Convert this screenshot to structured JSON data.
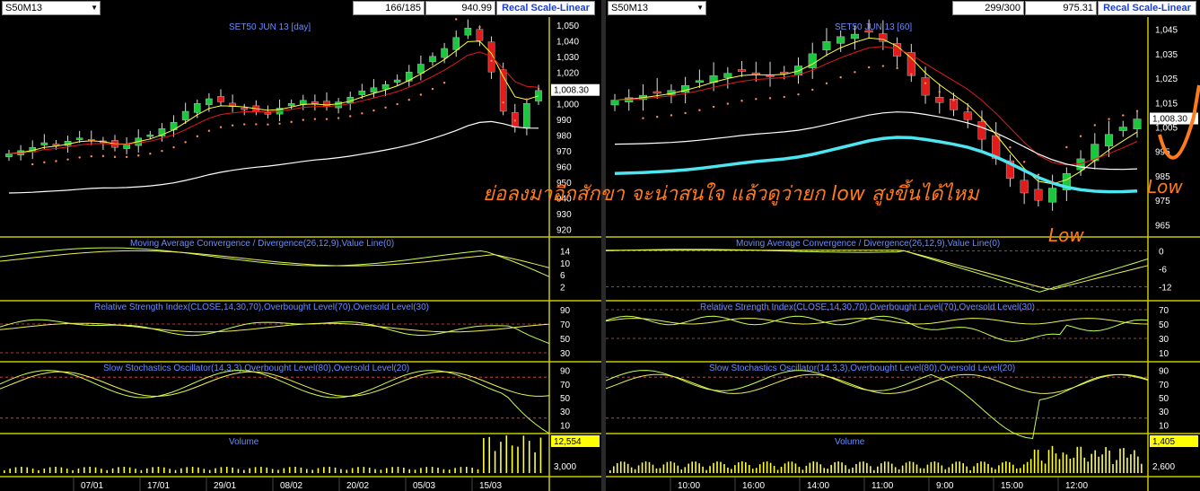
{
  "left": {
    "symbol": "S50M13",
    "bars_count": "166/185",
    "value": "940.99",
    "recal_label": "Recal Scale-Linear",
    "price_title": "SET50 JUN 13   [day]",
    "price_ticks": [
      "1,050",
      "1,040",
      "1,030",
      "1,020",
      "1,010",
      "1,000",
      "990",
      "980",
      "970",
      "960",
      "950",
      "940",
      "930",
      "920"
    ],
    "last_price": "1,008.30",
    "macd_title": "Moving Average Convergence / Divergence(26,12,9),Value Line(0)",
    "macd_ticks": [
      "14",
      "10",
      "6",
      "2"
    ],
    "rsi_title": "Relative Strength Index(CLOSE,14,30,70),Overbought Level(70),Oversold Level(30)",
    "rsi_ticks": [
      "90",
      "70",
      "50",
      "30"
    ],
    "stoch_title": "Slow Stochastics Oscillator(14,3,3),Overbought Level(80),Oversold Level(20)",
    "stoch_ticks": [
      "90",
      "70",
      "50",
      "30",
      "10"
    ],
    "volume_title": "Volume",
    "volume_last": "12,554",
    "volume_tick": "3,000",
    "dates": [
      "07/01",
      "17/01",
      "29/01",
      "08/02",
      "20/02",
      "05/03",
      "15/03"
    ]
  },
  "right": {
    "symbol": "S50M13",
    "bars_count": "299/300",
    "value": "975.31",
    "recal_label": "Recal Scale-Linear",
    "price_title": "SET50 JUN 13   [60]",
    "price_ticks": [
      "1,045",
      "1,035",
      "1,025",
      "1,015",
      "1,005",
      "995",
      "985",
      "975",
      "965"
    ],
    "last_price": "1,008.30",
    "macd_title": "Moving Average Convergence / Divergence(26,12,9),Value Line(0)",
    "macd_ticks": [
      "0",
      "-6",
      "-12"
    ],
    "rsi_title": "Relative Strength Index(CLOSE,14,30,70),Overbought Level(70),Oversold Level(30)",
    "rsi_ticks": [
      "70",
      "50",
      "30",
      "10"
    ],
    "stoch_title": "Slow Stochastics Oscillator(14,3,3),Overbought Level(80),Oversold Level(20)",
    "stoch_ticks": [
      "90",
      "70",
      "50",
      "30",
      "10"
    ],
    "volume_title": "Volume",
    "volume_last": "1,405",
    "volume_tick": "2,600",
    "times": [
      "10:00",
      "16:00",
      "14:00",
      "11:00",
      "9:00",
      "15:00",
      "12:00"
    ]
  },
  "annotations": {
    "main_text": "ย่อลงมาอีกสักขา จะน่าสนใจ แล้วดูว่ายก low สูงขึ้นได้ไหม",
    "low_label_1": "Low",
    "low_label_2": "Low"
  },
  "colors": {
    "up": "#19c83c",
    "down": "#e21b1b",
    "ma_fast": "#ffff3c",
    "ma_mid": "#e21b1b",
    "ma_slow": "#ffffff",
    "ma_cyan": "#4de6f0",
    "sar": "#ff8a5c",
    "panel_border": "#c8c800",
    "annotation": "#ff7a1a"
  },
  "chart_data": [
    {
      "type": "candlestick",
      "title": "SET50 JUN 13   [day]",
      "ylim": [
        915,
        1055
      ],
      "close_series": [
        968,
        970,
        972,
        975,
        974,
        976,
        978,
        977,
        975,
        972,
        974,
        978,
        980,
        984,
        988,
        995,
        1000,
        1003,
        1001,
        998,
        997,
        995,
        994,
        997,
        1000,
        1002,
        1000,
        998,
        1001,
        1004,
        1008,
        1010,
        1012,
        1015,
        1020,
        1025,
        1030,
        1035,
        1042,
        1048,
        1040,
        1020,
        995,
        985,
        1000,
        1008.3
      ],
      "x_tick_labels": [
        "07/01",
        "17/01",
        "29/01",
        "08/02",
        "20/02",
        "05/03",
        "15/03"
      ]
    },
    {
      "type": "candlestick",
      "title": "SET50 JUN 13   [60]",
      "ylim": [
        960,
        1050
      ],
      "close_series": [
        1016,
        1017,
        1018,
        1019,
        1020,
        1022,
        1024,
        1026,
        1027,
        1028,
        1027,
        1026,
        1027,
        1030,
        1035,
        1040,
        1042,
        1043,
        1044,
        1040,
        1034,
        1026,
        1018,
        1015,
        1012,
        1008,
        1000,
        992,
        984,
        978,
        975,
        980,
        986,
        992,
        998,
        1002,
        1005,
        1008.3
      ],
      "x_tick_labels": [
        "10:00",
        "16:00",
        "14:00",
        "11:00",
        "9:00",
        "15:00",
        "12:00"
      ]
    }
  ]
}
